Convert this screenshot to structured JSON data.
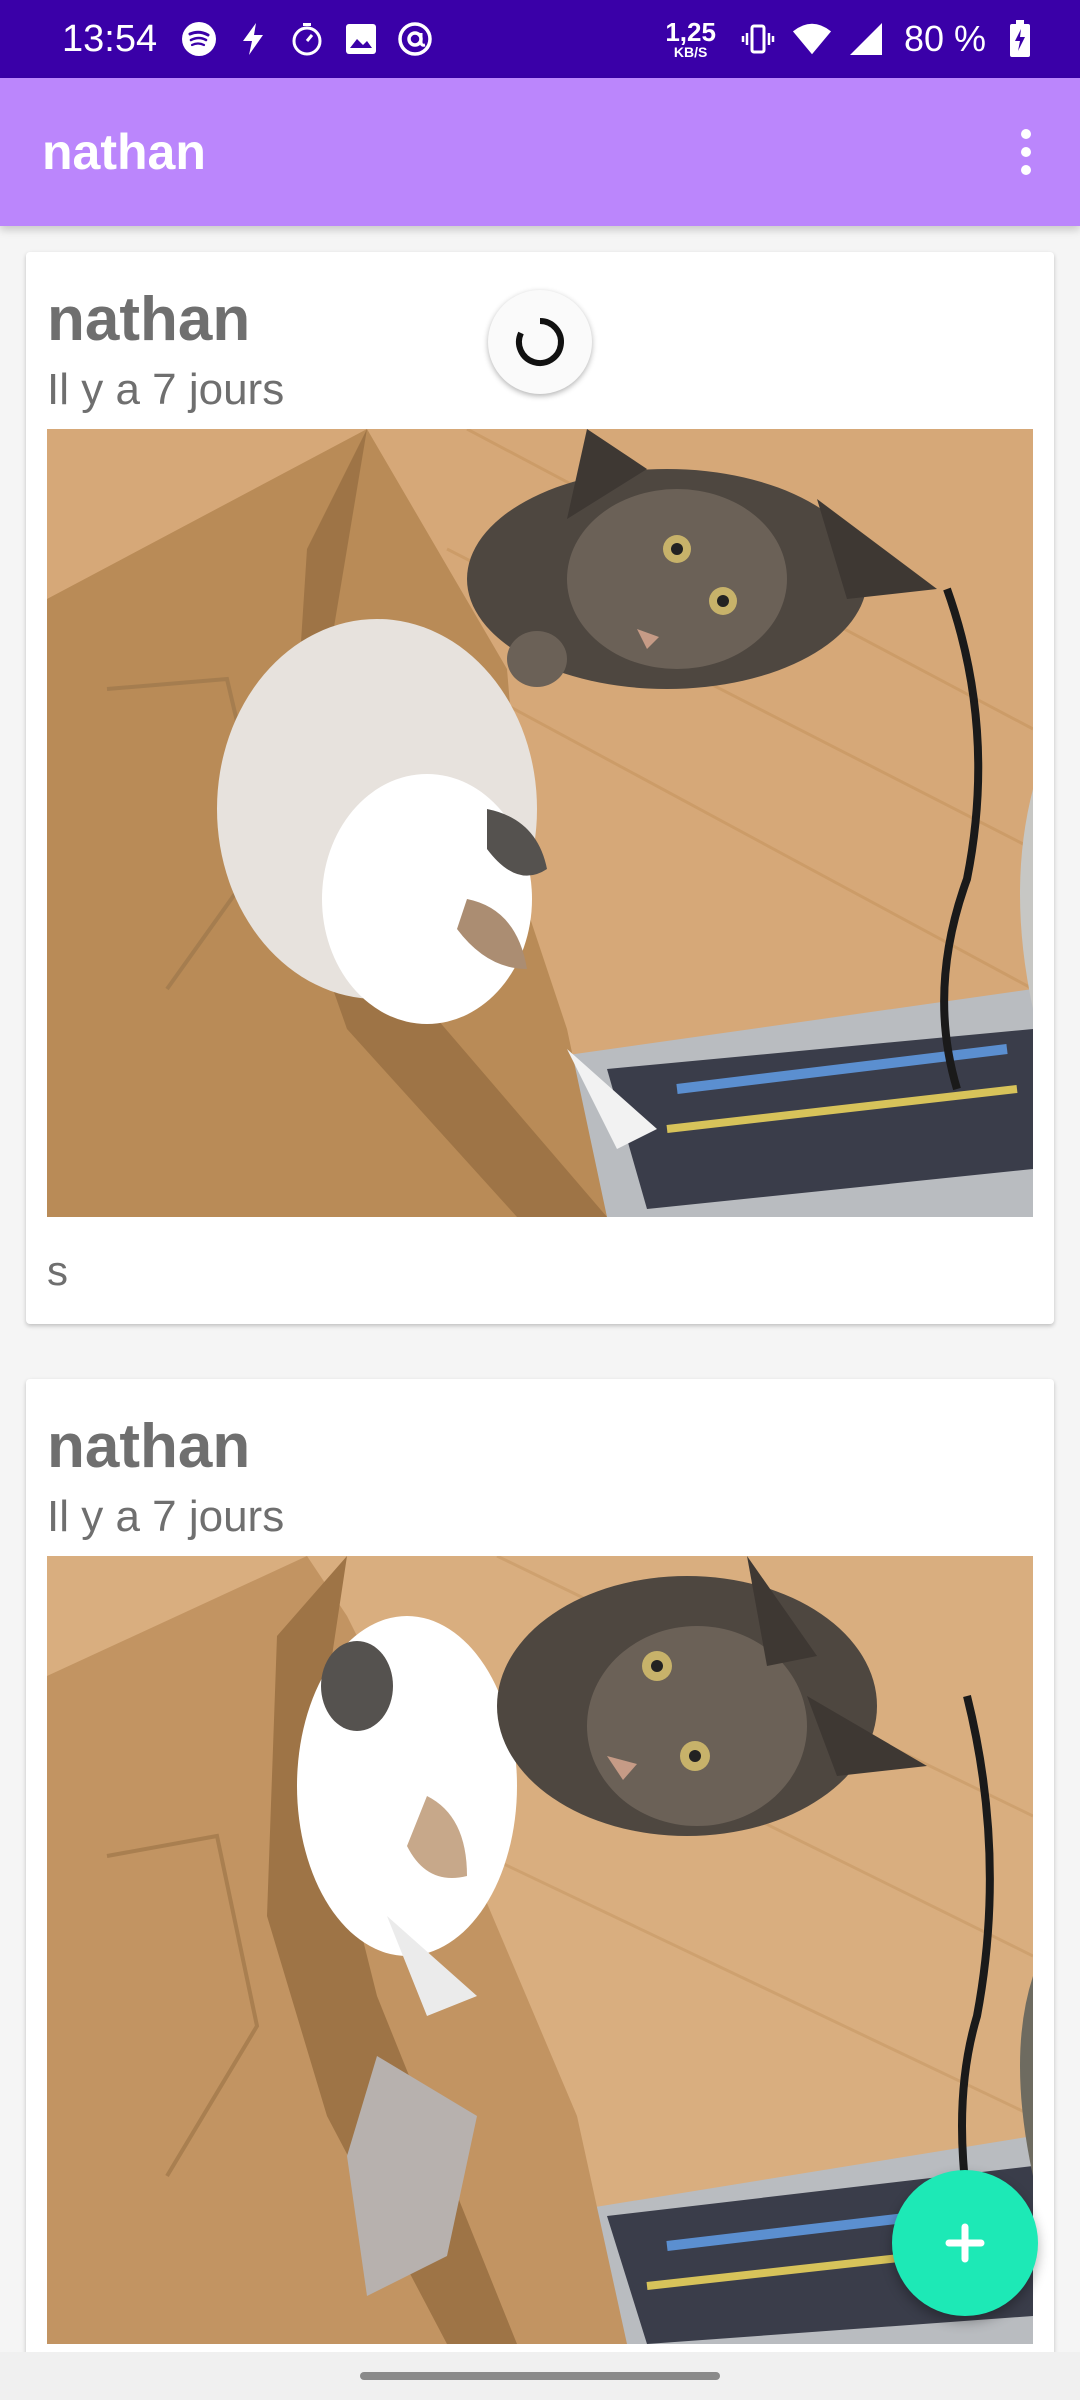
{
  "status_bar": {
    "time": "13:54",
    "net_speed_value": "1,25",
    "net_speed_unit": "KB/S",
    "battery": "80 %",
    "icons": [
      "spotify-icon",
      "flash-icon",
      "timer-icon",
      "image-icon",
      "at-icon",
      "vibrate-icon",
      "wifi-icon",
      "signal-icon",
      "battery-charging-icon"
    ]
  },
  "app_bar": {
    "title": "nathan",
    "menu_icon": "more-vert-icon"
  },
  "posts": [
    {
      "author": "nathan",
      "time": "Il y a 7 jours",
      "caption": "s",
      "image": "photo of two cats: a white cat in a brown paper bag and a tabby cat on a wooden floor"
    },
    {
      "author": "nathan",
      "time": "Il y a 7 jours",
      "caption": "",
      "image": "photo of two cats: a white cat in a brown paper bag and a tabby cat on a wooden floor"
    }
  ],
  "fab": {
    "icon": "add-icon"
  },
  "colors": {
    "status_bar": "#3a00a8",
    "app_bar": "#bb86fc",
    "fab": "#1de9b6",
    "text_secondary": "#6f6f6f"
  }
}
